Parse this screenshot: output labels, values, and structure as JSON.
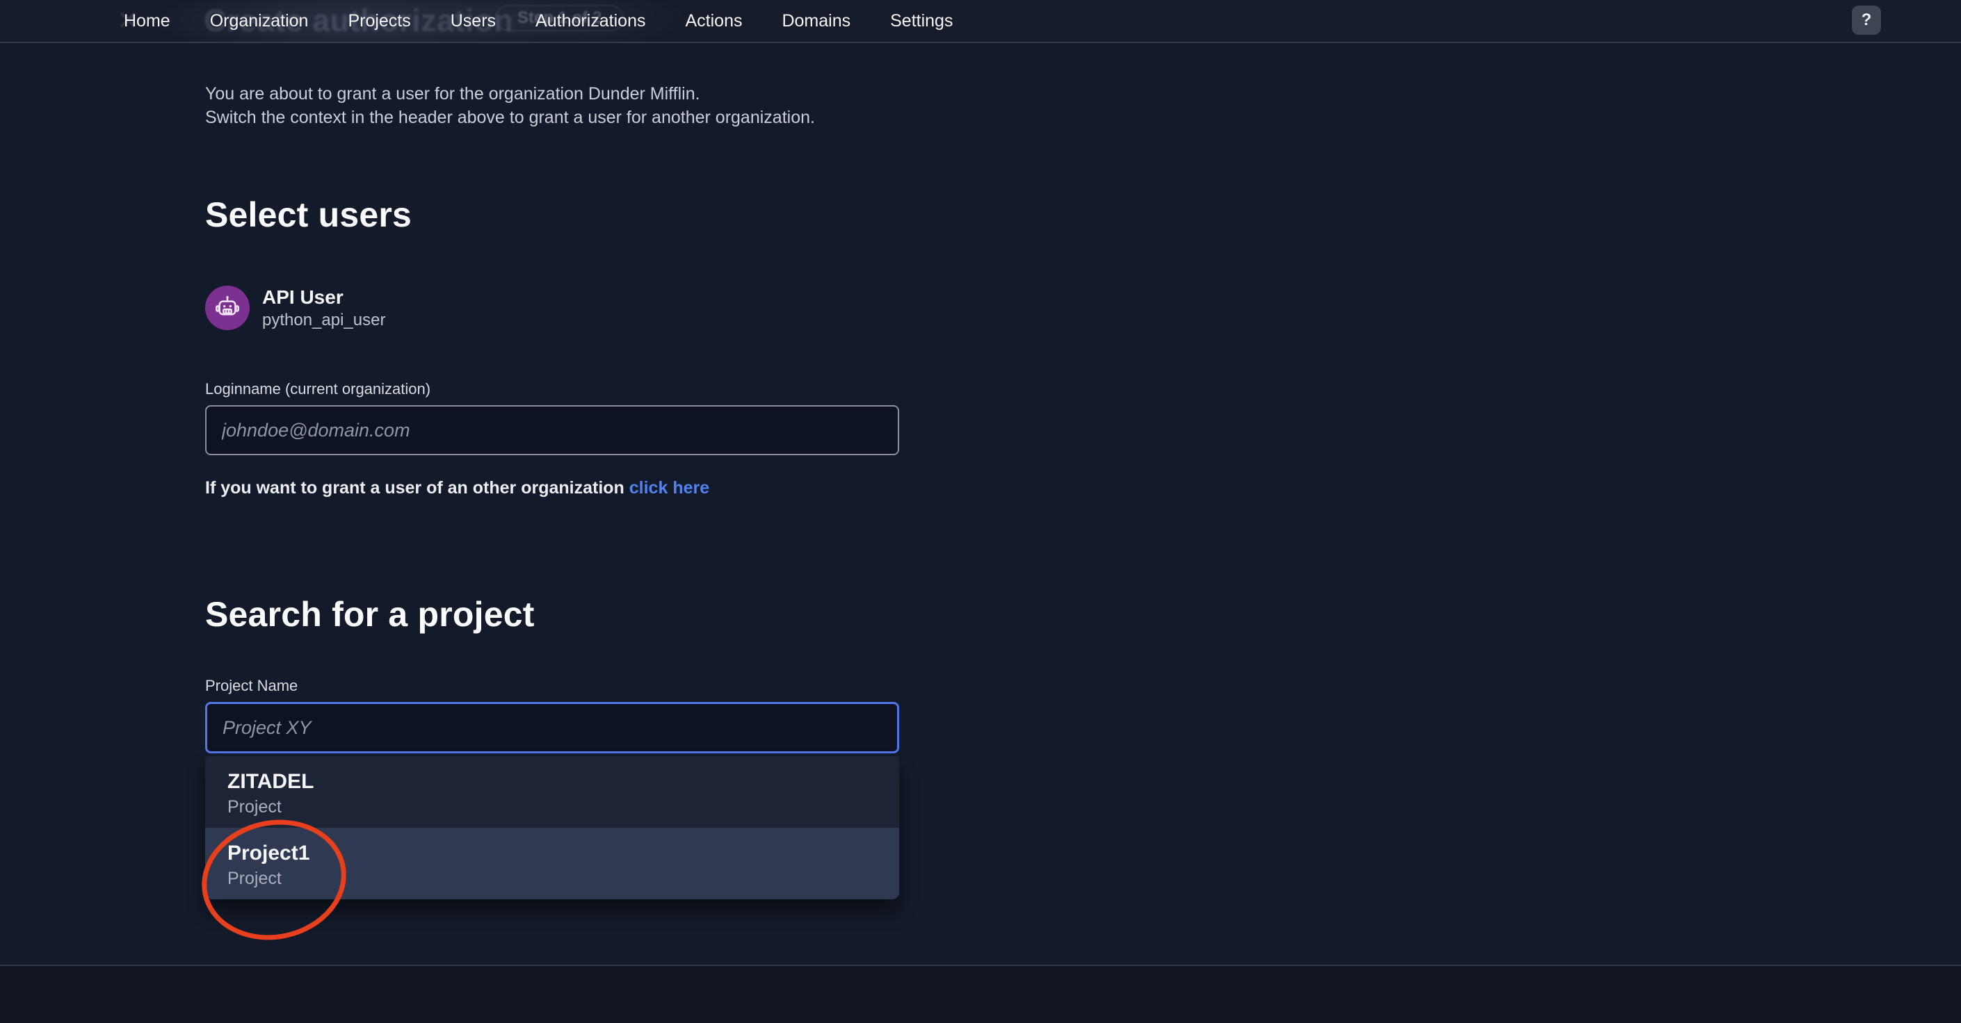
{
  "nav": {
    "items": [
      "Home",
      "Organization",
      "Projects",
      "Users",
      "Authorizations",
      "Actions",
      "Domains",
      "Settings"
    ],
    "help_label": "?"
  },
  "ghost": {
    "title": "Create authorization",
    "step_badge": "Step 1 of 2",
    "close_icon": "✕"
  },
  "intro": {
    "line1": "You are about to grant a user for the organization Dunder Mifflin.",
    "line2": "Switch the context in the header above to grant a user for another organization."
  },
  "select_users": {
    "heading": "Select users",
    "user": {
      "name": "API User",
      "username": "python_api_user",
      "avatar_color": "#7c3191",
      "avatar_icon": "robot-icon"
    },
    "loginname_label": "Loginname (current organization)",
    "loginname_placeholder": "johndoe@domain.com",
    "other_org_text": "If you want to grant a user of an other organization",
    "other_org_link": "click here"
  },
  "project_search": {
    "heading": "Search for a project",
    "label": "Project Name",
    "placeholder": "Project XY",
    "options": [
      {
        "name": "ZITADEL",
        "type": "Project",
        "highlighted": false
      },
      {
        "name": "Project1",
        "type": "Project",
        "highlighted": true
      }
    ]
  },
  "annotation": {
    "shape": "ellipse",
    "color": "#e83f1d",
    "target": "Project1"
  },
  "colors": {
    "background": "#131a29",
    "nav_background": "#161c2a",
    "accent_blue": "#5282ed",
    "focus_border": "#5076e8",
    "dropdown_item": "#1d2436",
    "dropdown_item_highlighted": "#2f3951",
    "avatar_purple": "#7c3191",
    "annotation_red": "#e83f1d"
  }
}
